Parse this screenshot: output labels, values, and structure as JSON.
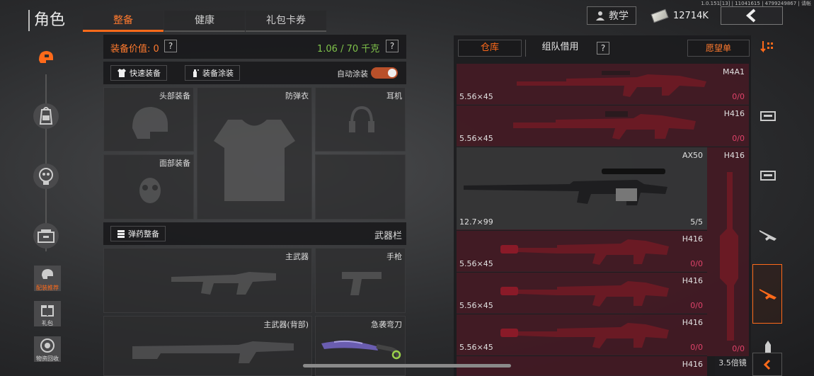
{
  "header": {
    "title": "角色",
    "tabs": [
      {
        "label": "整备",
        "active": true
      },
      {
        "label": "健康",
        "active": false
      },
      {
        "label": "礼包卡券",
        "active": false
      }
    ],
    "version": "1.0.151[13] | 11041615 | 4799249867 | 请帐",
    "teach_label": "教学",
    "money": "12714K"
  },
  "left_nav": {
    "items": [
      {
        "icon": "helmet-icon"
      },
      {
        "icon": "backpack-icon"
      },
      {
        "icon": "body-icon"
      },
      {
        "icon": "crate-icon"
      }
    ],
    "buttons": [
      {
        "label": "配装推荐",
        "icon": "loadout-icon"
      },
      {
        "label": "礼包",
        "icon": "gift-icon"
      },
      {
        "label": "物资回收",
        "icon": "recycle-icon"
      }
    ]
  },
  "equip": {
    "value_label": "装备价值: 0",
    "weight": "1.06 / 70 千克",
    "quick_equip": "快速装备",
    "equip_paint": "装备涂装",
    "auto_paint": "自动涂装",
    "slots": {
      "head": "头部装备",
      "armor": "防弹衣",
      "ear": "耳机",
      "face": "面部装备",
      "ammo_btn": "弹药整备",
      "weapon_bar": "武器栏",
      "primary": "主武器",
      "pistol": "手枪",
      "primary_back": "主武器(背部)",
      "melee": "急袭弯刀"
    }
  },
  "warehouse": {
    "tab_warehouse": "仓库",
    "tab_team": "组队借用",
    "wishlist": "愿望单",
    "items": [
      {
        "name": "M4A1",
        "caliber": "5.56×45",
        "count": "0/0"
      },
      {
        "name": "H416",
        "caliber": "5.56×45",
        "count": "0/0"
      },
      {
        "name": "AX50",
        "caliber": "12.7×99",
        "count": "5/5"
      },
      {
        "name": "H416",
        "caliber": "5.56×45",
        "count": "0/0"
      },
      {
        "name": "H416",
        "caliber": "5.56×45",
        "count": "0/0"
      },
      {
        "name": "H416",
        "caliber": "5.56×45",
        "count": "0/0"
      },
      {
        "name": "H416",
        "caliber": "",
        "count": ""
      }
    ],
    "side_item": {
      "name": "H416",
      "count": "0/0"
    },
    "scope": "3.5倍镜"
  },
  "colors": {
    "accent": "#ff6a1a",
    "weight_green": "#7fc24a",
    "count_red": "#e0436a",
    "item_red": "#5f1928"
  }
}
